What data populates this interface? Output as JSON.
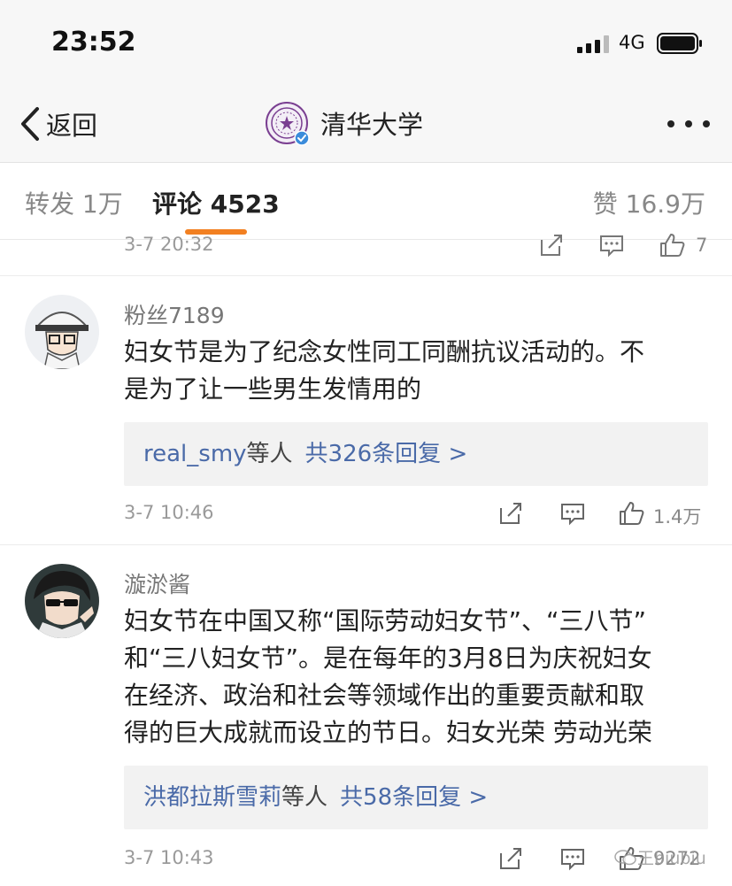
{
  "status_bar": {
    "time": "23:52",
    "network": "4G"
  },
  "nav": {
    "back_label": "返回",
    "title": "清华大学",
    "logo_icon": "tsinghua-seal-icon",
    "verified_icon": "verified-badge-icon",
    "more_icon": "more-dots-icon"
  },
  "tabs": {
    "forward": "转发 1万",
    "comments": "评论 4523",
    "likes": "赞 16.9万",
    "active_color": "#f28021"
  },
  "prev_comment": {
    "time": "3-7 20:32",
    "like_count": "7"
  },
  "comments": [
    {
      "username": "粉丝7189",
      "lines": [
        "妇女节是为了纪念女性同工同酬抗议活动的。不",
        "是为了让一些男生发情用的"
      ],
      "reply_users": "real_smy",
      "reply_etc": "等人",
      "reply_count": "共326条回复 >",
      "time": "3-7 10:46",
      "like_count": "1.4万"
    },
    {
      "username": "漩淤酱",
      "lines": [
        "妇女节在中国又称“国际劳动妇女节”、“三八节”",
        "和“三八妇女节”。是在每年的3月8日为庆祝妇女",
        "在经济、政治和社会等领域作出的重要贡献和取",
        "得的巨大成就而设立的节日。妇女光荣 劳动光荣"
      ],
      "reply_users": "洪都拉斯雪莉",
      "reply_etc": "等人",
      "reply_count": "共58条回复 >",
      "time": "3-7 10:43",
      "like_count": "9272"
    }
  ],
  "watermark": "王biubiu",
  "colors": {
    "link": "#4a6aa8",
    "accent": "#f28021",
    "verified": "#3b8cdb",
    "seal": "#7a3f91"
  }
}
